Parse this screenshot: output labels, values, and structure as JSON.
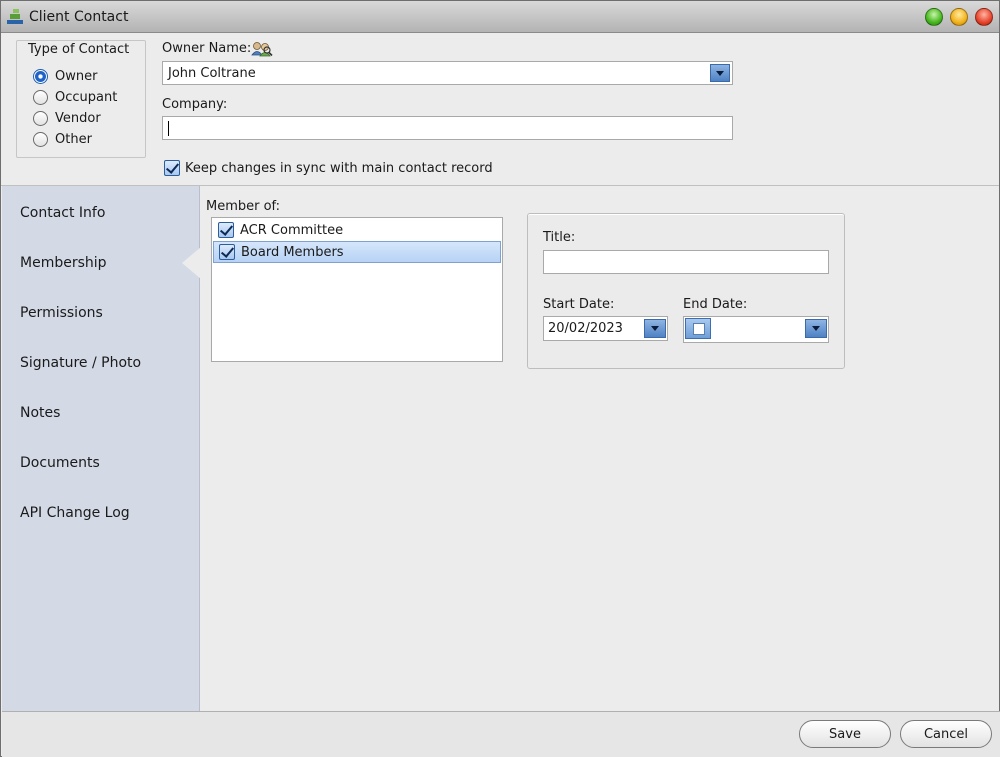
{
  "window": {
    "title": "Client Contact"
  },
  "type_of_contact": {
    "legend": "Type of Contact",
    "options": [
      {
        "label": "Owner",
        "selected": true
      },
      {
        "label": "Occupant",
        "selected": false
      },
      {
        "label": "Vendor",
        "selected": false
      },
      {
        "label": "Other",
        "selected": false
      }
    ]
  },
  "owner": {
    "label": "Owner Name:",
    "value": "John Coltrane",
    "lookup_icon": "people-search-icon"
  },
  "company": {
    "label": "Company:",
    "value": ""
  },
  "sync": {
    "label": "Keep changes in sync with main contact record",
    "checked": true
  },
  "sidebar": {
    "items": [
      {
        "label": "Contact Info"
      },
      {
        "label": "Membership",
        "active": true
      },
      {
        "label": "Permissions"
      },
      {
        "label": "Signature / Photo"
      },
      {
        "label": "Notes"
      },
      {
        "label": "Documents"
      },
      {
        "label": "API Change Log"
      }
    ]
  },
  "membership": {
    "label": "Member of:",
    "groups": [
      {
        "name": "ACR Committee",
        "checked": true,
        "selected": false
      },
      {
        "name": "Board Members",
        "checked": true,
        "selected": true
      }
    ],
    "title_label": "Title:",
    "title_value": "",
    "start_date_label": "Start Date:",
    "start_date_value": "20/02/2023",
    "end_date_label": "End Date:",
    "end_date_value": ""
  },
  "footer": {
    "save_label": "Save",
    "cancel_label": "Cancel"
  },
  "colors": {
    "sidebar_bg": "#d3dae6",
    "accent_blue": "#4f82c4",
    "selected_row": "#b7d3f5"
  }
}
